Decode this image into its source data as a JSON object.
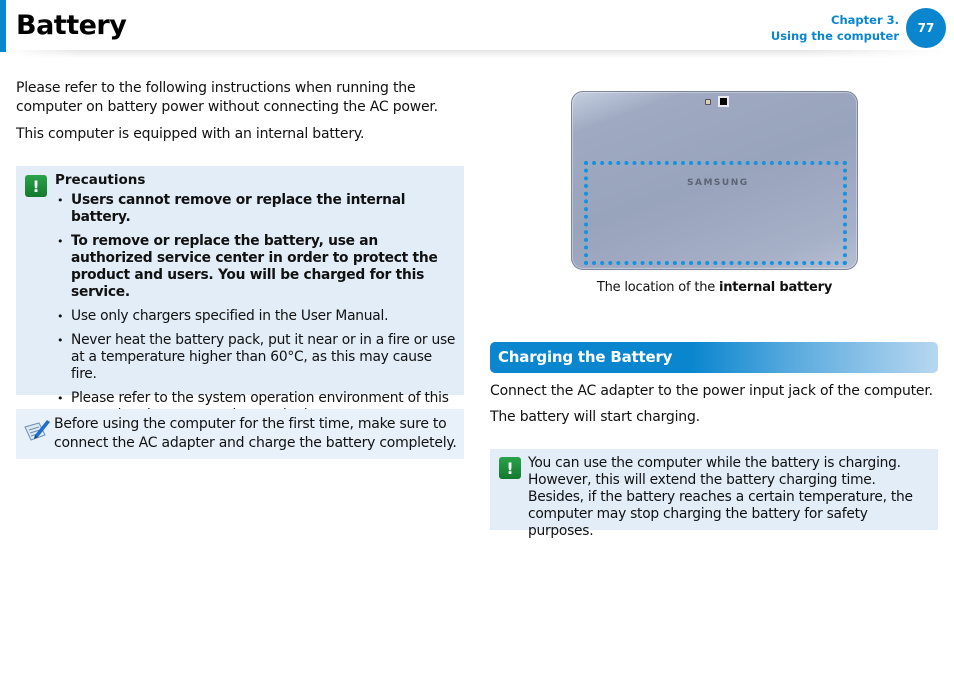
{
  "header": {
    "title": "Battery",
    "chapter_line1": "Chapter 3.",
    "chapter_line2": "Using the computer",
    "page_number": "77",
    "accent_color": "#0a86cf"
  },
  "intro": {
    "paragraph1": "Please refer to the following instructions when running the computer on battery power without connecting the AC power.",
    "paragraph2": "This computer is equipped with an internal battery."
  },
  "precautions": {
    "icon": "warning-exclamation-icon",
    "heading": "Precautions",
    "items": [
      {
        "text": "Users cannot remove or replace the internal battery.",
        "bold": true
      },
      {
        "text": "To remove or replace the battery, use an authorized service center in order to protect the product and users. You will be charged for this service.",
        "bold": true
      },
      {
        "text": "Use only chargers specified in the User Manual.",
        "bold": false
      },
      {
        "text": "Never heat the battery pack, put it near or in a fire or use at a temperature higher than 60°C, as this may cause fire.",
        "bold": false
      },
      {
        "text": "Please refer to the system operation environment of this manual and operate and store the battery at room temperature.",
        "bold": false
      }
    ]
  },
  "note": {
    "icon": "note-pencil-icon",
    "text": "Before using the computer for the first time, make sure to connect the AC adapter and charge the battery completely."
  },
  "figure": {
    "device_logo": "SAMSUNG",
    "caption_prefix": "The location of the ",
    "caption_bold": "internal battery",
    "highlight_color": "#1592e0"
  },
  "charging": {
    "section_title": "Charging the Battery",
    "paragraph1": "Connect the AC adapter to the power input jack of the computer.",
    "paragraph2": "The battery will start charging.",
    "tip_icon": "warning-exclamation-icon",
    "tip_text": "You can use the computer while the battery is charging. However, this will extend the battery charging time. Besides, if the battery reaches a certain temperature, the computer may stop charging the battery for safety purposes."
  }
}
